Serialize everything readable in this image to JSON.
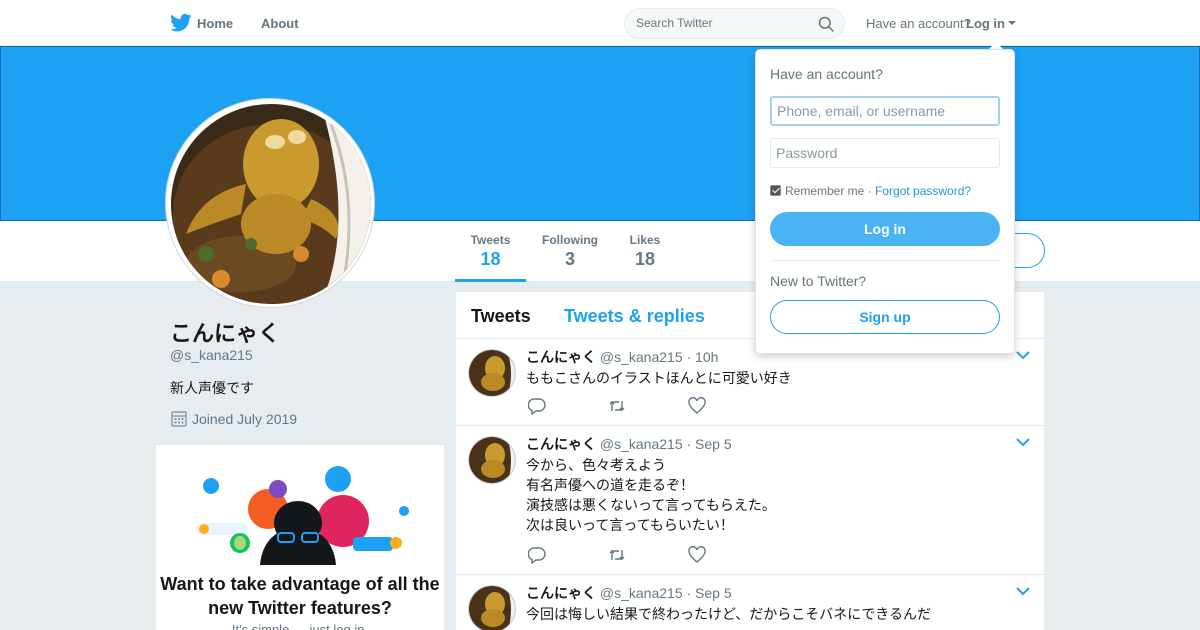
{
  "colors": {
    "brand": "#1da1f2",
    "banner": "#1da1f2",
    "login_button": "#4ab3f4"
  },
  "nav": {
    "logo_icon": "twitter-bird-icon",
    "home": "Home",
    "about": "About",
    "search_placeholder": "Search Twitter",
    "have_account": "Have an account?",
    "login": "Log in"
  },
  "profile": {
    "name": "こんにゃく",
    "handle": "@s_kana215",
    "bio": "新人声優です",
    "joined": "Joined July 2019",
    "stats": [
      {
        "label": "Tweets",
        "value": "18"
      },
      {
        "label": "Following",
        "value": "3"
      },
      {
        "label": "Likes",
        "value": "18"
      }
    ]
  },
  "promo": {
    "title": "Want to take advantage of all the new Twitter features?",
    "subtitle": "It's simple — just log in."
  },
  "timeline": {
    "tabs": [
      "Tweets",
      "Tweets & replies"
    ],
    "tweets": [
      {
        "name": "こんにゃく",
        "meta": "@s_kana215 · 10h",
        "lines": [
          "ももこさんのイラストほんとに可愛い好き"
        ]
      },
      {
        "name": "こんにゃく",
        "meta": "@s_kana215 · Sep 5",
        "lines": [
          "今から、色々考えよう",
          "有名声優への道を走るぞ！",
          "演技感は悪くないって言ってもらえた。",
          "次は良いって言ってもらいたい！"
        ]
      },
      {
        "name": "こんにゃく",
        "meta": "@s_kana215 · Sep 5",
        "lines": [
          "今回は悔しい結果で終わったけど、だからこそバネにできるんだ"
        ]
      }
    ]
  },
  "login_dropdown": {
    "title": "Have an account?",
    "username_placeholder": "Phone, email, or username",
    "password_placeholder": "Password",
    "remember": "Remember me",
    "separator": " · ",
    "forgot": "Forgot password?",
    "login_button": "Log in",
    "new_to": "New to Twitter?",
    "signup_button": "Sign up"
  }
}
